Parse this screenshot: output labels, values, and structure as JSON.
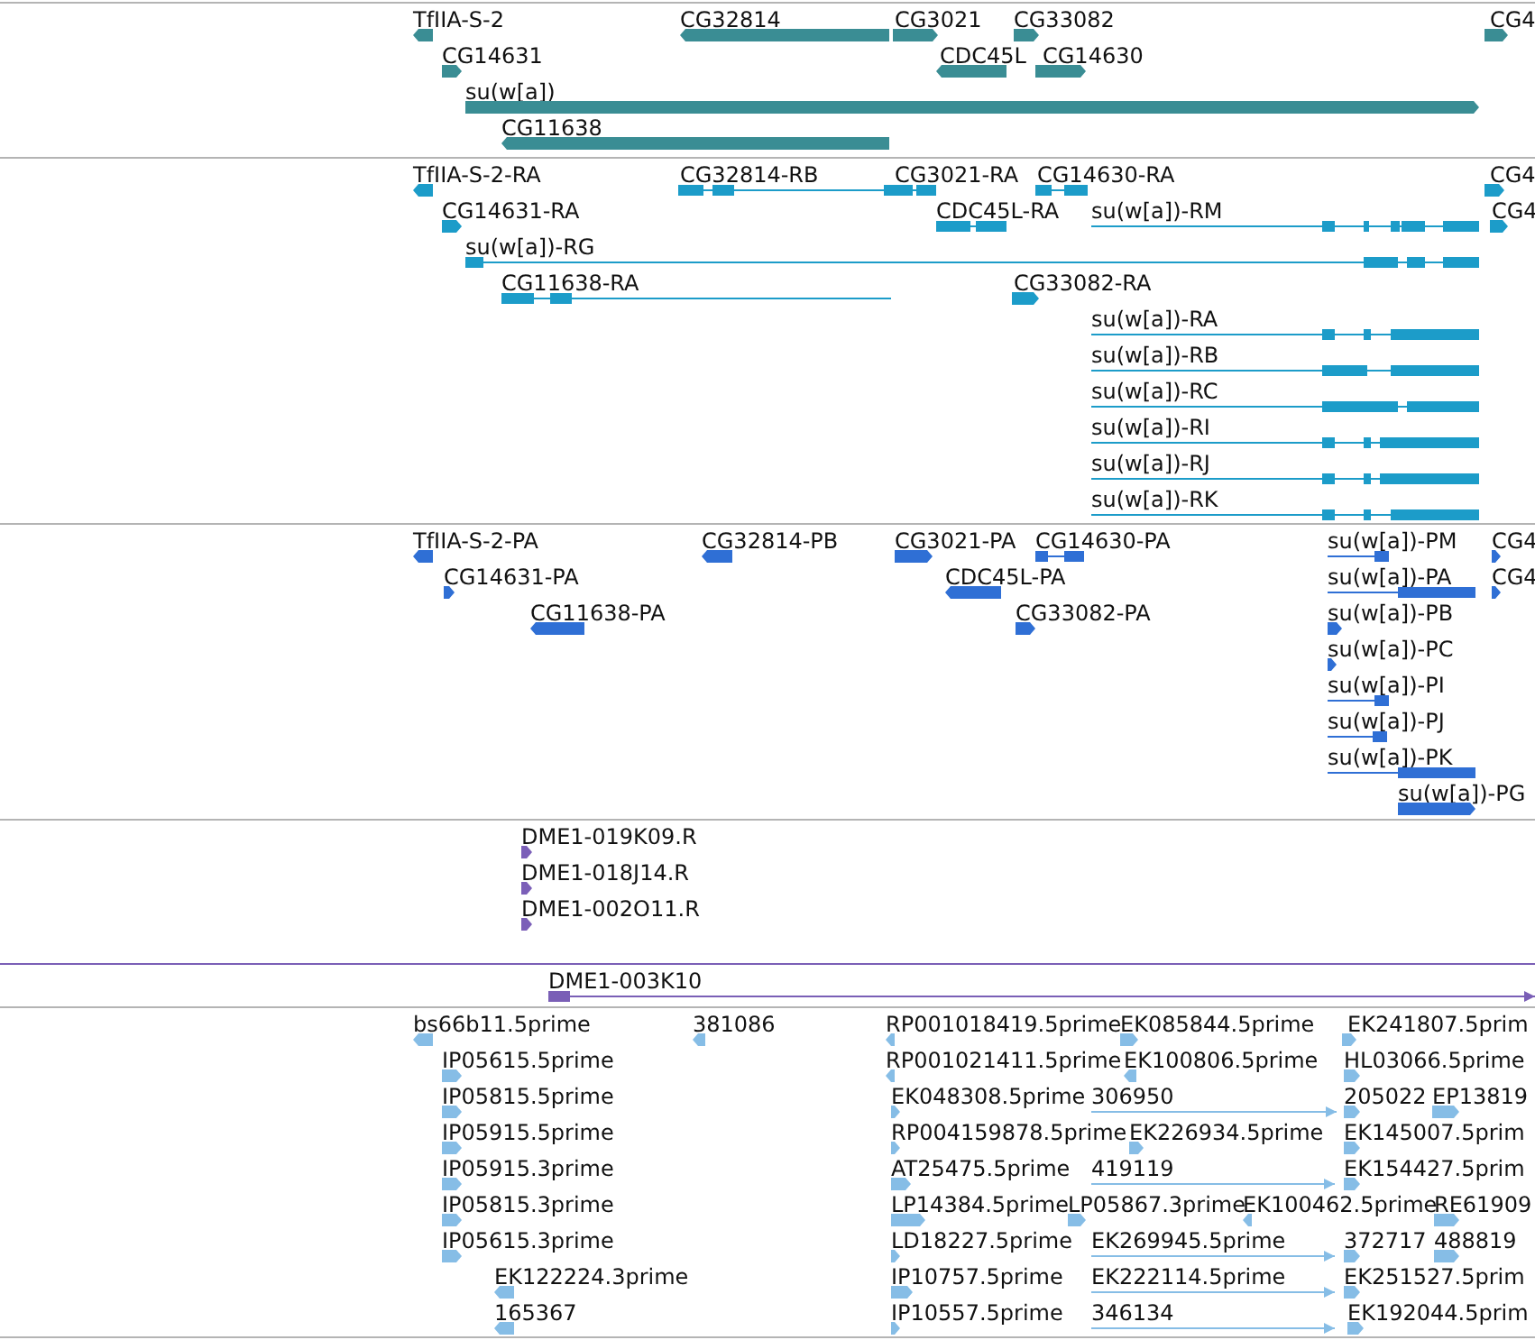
{
  "tracks": [
    {
      "kind": "gene",
      "features": [
        {
          "label": "TfIIA-S-2"
        },
        {
          "label": "CG32814"
        },
        {
          "label": "CG3021"
        },
        {
          "label": "CG33082"
        },
        {
          "label": "CG4"
        },
        {
          "label": "CG14631"
        },
        {
          "label": "CDC45L"
        },
        {
          "label": "CG14630"
        },
        {
          "label": "su(w[a])"
        },
        {
          "label": "CG11638"
        }
      ]
    },
    {
      "kind": "mrna",
      "features": [
        {
          "label": "TfIIA-S-2-RA"
        },
        {
          "label": "CG32814-RB"
        },
        {
          "label": "CG3021-RA"
        },
        {
          "label": "CG14630-RA"
        },
        {
          "label": "CG4"
        },
        {
          "label": "CG14631-RA"
        },
        {
          "label": "CDC45L-RA"
        },
        {
          "label": "su(w[a])-RM"
        },
        {
          "label": "CG4"
        },
        {
          "label": "su(w[a])-RG"
        },
        {
          "label": "CG11638-RA"
        },
        {
          "label": "CG33082-RA"
        },
        {
          "label": "su(w[a])-RA"
        },
        {
          "label": "su(w[a])-RB"
        },
        {
          "label": "su(w[a])-RC"
        },
        {
          "label": "su(w[a])-RI"
        },
        {
          "label": "su(w[a])-RJ"
        },
        {
          "label": "su(w[a])-RK"
        }
      ]
    },
    {
      "kind": "protein",
      "features": [
        {
          "label": "TfIIA-S-2-PA"
        },
        {
          "label": "CG32814-PB"
        },
        {
          "label": "CG3021-PA"
        },
        {
          "label": "CG14630-PA"
        },
        {
          "label": "su(w[a])-PM"
        },
        {
          "label": "CG4"
        },
        {
          "label": "CG14631-PA"
        },
        {
          "label": "CDC45L-PA"
        },
        {
          "label": "su(w[a])-PA"
        },
        {
          "label": "CG4"
        },
        {
          "label": "CG11638-PA"
        },
        {
          "label": "CG33082-PA"
        },
        {
          "label": "su(w[a])-PB"
        },
        {
          "label": "su(w[a])-PC"
        },
        {
          "label": "su(w[a])-PI"
        },
        {
          "label": "su(w[a])-PJ"
        },
        {
          "label": "su(w[a])-PK"
        },
        {
          "label": "su(w[a])-PG"
        }
      ]
    },
    {
      "kind": "read",
      "features": [
        {
          "label": "DME1-019K09.R"
        },
        {
          "label": "DME1-018J14.R"
        },
        {
          "label": "DME1-002O11.R"
        }
      ]
    },
    {
      "kind": "clone",
      "features": [
        {
          "label": "DME1-003K10"
        }
      ]
    },
    {
      "kind": "est",
      "features": [
        {
          "label": "bs66b11.5prime"
        },
        {
          "label": "381086"
        },
        {
          "label": "RP001018419.5prime"
        },
        {
          "label": "EK085844.5prime"
        },
        {
          "label": "EK241807.5prim"
        },
        {
          "label": "IP05615.5prime"
        },
        {
          "label": "RP001021411.5prime"
        },
        {
          "label": "EK100806.5prime"
        },
        {
          "label": "HL03066.5prime"
        },
        {
          "label": "IP05815.5prime"
        },
        {
          "label": "EK048308.5prime"
        },
        {
          "label": "306950"
        },
        {
          "label": "205022"
        },
        {
          "label": "EP13819"
        },
        {
          "label": "IP05915.5prime"
        },
        {
          "label": "RP004159878.5prime"
        },
        {
          "label": "EK226934.5prime"
        },
        {
          "label": "EK145007.5prim"
        },
        {
          "label": "IP05915.3prime"
        },
        {
          "label": "AT25475.5prime"
        },
        {
          "label": "419119"
        },
        {
          "label": "EK154427.5prim"
        },
        {
          "label": "IP05815.3prime"
        },
        {
          "label": "LP14384.5prime"
        },
        {
          "label": "LP05867.3prime"
        },
        {
          "label": "EK100462.5prime"
        },
        {
          "label": "RE61909"
        },
        {
          "label": "IP05615.3prime"
        },
        {
          "label": "LD18227.5prime"
        },
        {
          "label": "EK269945.5prime"
        },
        {
          "label": "372717"
        },
        {
          "label": "488819"
        },
        {
          "label": "EK122224.3prime"
        },
        {
          "label": "IP10757.5prime"
        },
        {
          "label": "EK222114.5prime"
        },
        {
          "label": "EK251527.5prim"
        },
        {
          "label": "165367"
        },
        {
          "label": "IP10557.5prime"
        },
        {
          "label": "346134"
        },
        {
          "label": "EK192044.5prim"
        }
      ]
    }
  ]
}
